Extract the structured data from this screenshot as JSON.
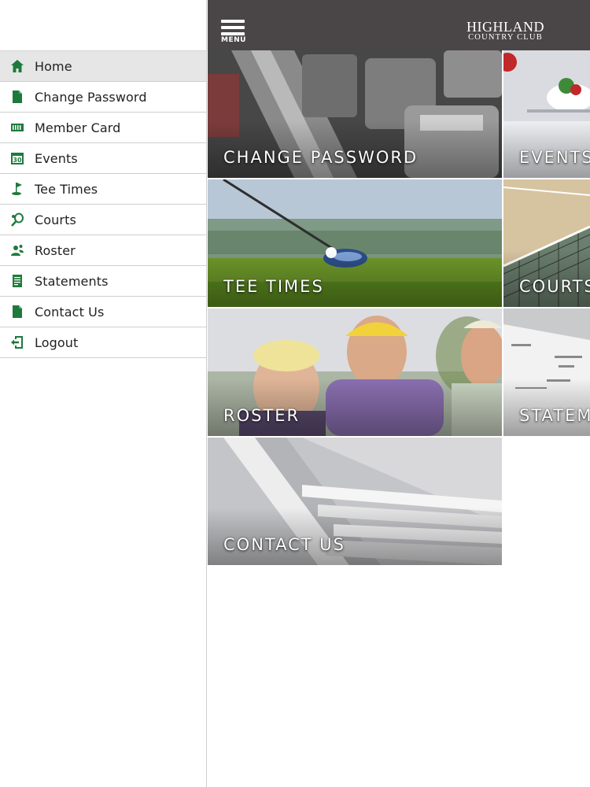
{
  "sidebar": {
    "items": [
      {
        "label": "Home",
        "icon": "home-icon",
        "active": true
      },
      {
        "label": "Change Password",
        "icon": "document-icon"
      },
      {
        "label": "Member Card",
        "icon": "member-card-icon"
      },
      {
        "label": "Events",
        "icon": "calendar-icon",
        "calendar_day": "30"
      },
      {
        "label": "Tee Times",
        "icon": "golf-flag-icon"
      },
      {
        "label": "Courts",
        "icon": "tennis-racket-icon"
      },
      {
        "label": "Roster",
        "icon": "people-icon"
      },
      {
        "label": "Statements",
        "icon": "statement-icon"
      },
      {
        "label": "Contact Us",
        "icon": "document-icon"
      },
      {
        "label": "Logout",
        "icon": "logout-icon"
      }
    ]
  },
  "header": {
    "menu_label": "MENU",
    "brand_line1": "HIGHLAND",
    "brand_line2": "COUNTRY CLUB"
  },
  "tiles": [
    {
      "label": "CHANGE PASSWORD",
      "image": "dumbbells"
    },
    {
      "label": "EVENTS",
      "image": "dining-table"
    },
    {
      "label": "TEE TIMES",
      "image": "golf-club"
    },
    {
      "label": "COURTS",
      "image": "tennis-net"
    },
    {
      "label": "ROSTER",
      "image": "smiling-people"
    },
    {
      "label": "STATEM",
      "image": "statement-paper"
    },
    {
      "label": "CONTACT US",
      "image": "envelopes"
    }
  ],
  "colors": {
    "accent_green": "#1e7a3c",
    "header_bg": "#4a4647",
    "active_item_bg": "#e6e6e6"
  }
}
